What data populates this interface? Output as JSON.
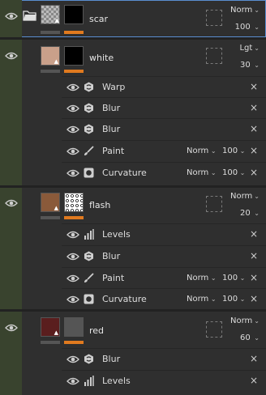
{
  "layers": [
    {
      "name": "scar",
      "blend": "Norm",
      "opacity": "100",
      "selected": true,
      "swatch": "checker",
      "effects": []
    },
    {
      "name": "white",
      "blend": "Lgt",
      "opacity": "30",
      "swatch": "#c9a08a",
      "effects": [
        {
          "name": "Warp",
          "icon": "warp-icon"
        },
        {
          "name": "Blur",
          "icon": "blur-icon"
        },
        {
          "name": "Blur",
          "icon": "blur-icon"
        },
        {
          "name": "Paint",
          "icon": "brush-icon",
          "blend": "Norm",
          "opacity": "100"
        },
        {
          "name": "Curvature",
          "icon": "curvature-icon",
          "blend": "Norm",
          "opacity": "100"
        }
      ]
    },
    {
      "name": "flash",
      "blend": "Norm",
      "opacity": "20",
      "swatch": "#8a5a3a",
      "effects": [
        {
          "name": "Levels",
          "icon": "levels-icon"
        },
        {
          "name": "Blur",
          "icon": "blur-icon"
        },
        {
          "name": "Paint",
          "icon": "brush-icon",
          "blend": "Norm",
          "opacity": "100"
        },
        {
          "name": "Curvature",
          "icon": "curvature-icon",
          "blend": "Norm",
          "opacity": "100"
        }
      ]
    },
    {
      "name": "red",
      "blend": "Norm",
      "opacity": "60",
      "swatch": "#5a1e1e",
      "effects": [
        {
          "name": "Blur",
          "icon": "blur-icon"
        },
        {
          "name": "Levels",
          "icon": "levels-icon"
        }
      ]
    }
  ],
  "close_glyph": "×",
  "colors": {
    "accent_bar": "#e07a1f",
    "visibility_column": "#39432e",
    "selection_outline": "#5a8ed0"
  }
}
